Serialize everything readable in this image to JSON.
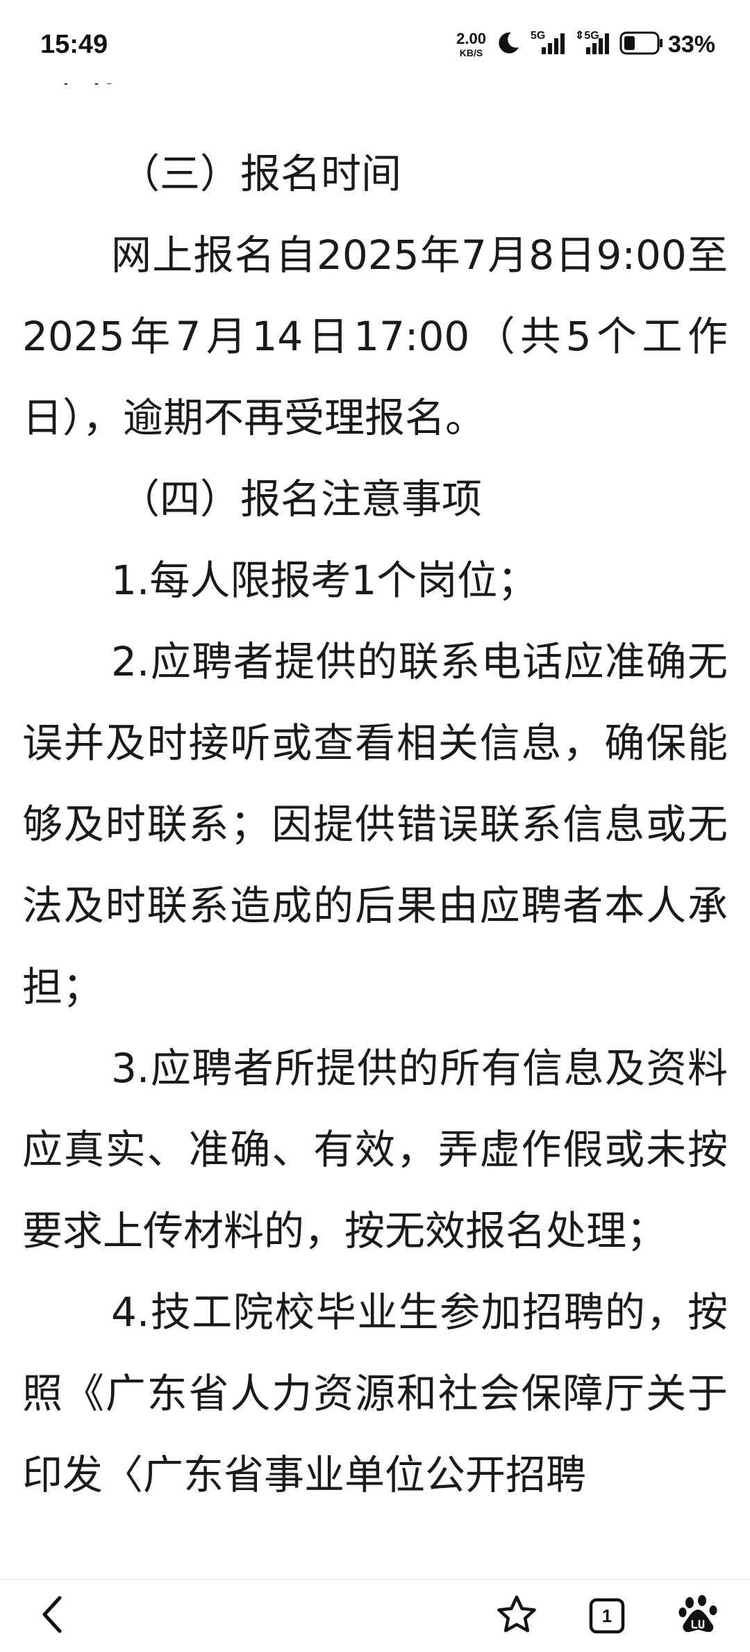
{
  "status_bar": {
    "time": "15:49",
    "net_speed_value": "2.00",
    "net_speed_unit": "KB/S",
    "signal_1_label": "5G",
    "signal_2_label": "5G",
    "battery_percent": "33%",
    "battery_level": 0.33,
    "icons": [
      "moon-icon",
      "signal-icon",
      "signal-icon",
      "battery-icon"
    ]
  },
  "article": {
    "cut_top_line": "证图。",
    "paragraphs": [
      {
        "type": "heading",
        "text": "（三）报名时间"
      },
      {
        "type": "body",
        "text": "网上报名自2025年7月8日9:00至2025年7月14日17:00（共5个工作日），逾期不再受理报名。"
      },
      {
        "type": "heading",
        "text": "（四）报名注意事项"
      },
      {
        "type": "body",
        "text": "1.每人限报考1个岗位；"
      },
      {
        "type": "body",
        "text": "2.应聘者提供的联系电话应准确无误并及时接听或查看相关信息，确保能够及时联系；因提供错误联系信息或无法及时联系造成的后果由应聘者本人承担；"
      },
      {
        "type": "body",
        "text": "3.应聘者所提供的所有信息及资料应真实、准确、有效，弄虚作假或未按要求上传材料的，按无效报名处理；"
      },
      {
        "type": "body",
        "text": "4.技工院校毕业生参加招聘的，按照《广东省人力资源和社会保障厅关于印发〈广东省事业单位公开招聘"
      }
    ]
  },
  "bottom_bar": {
    "tab_count": "1",
    "icons": [
      "back-icon",
      "star-icon",
      "tabs-icon",
      "baidu-paw-icon"
    ]
  },
  "colors": {
    "text": "#1a1a1a",
    "background": "#ffffff",
    "icon": "#111111"
  }
}
